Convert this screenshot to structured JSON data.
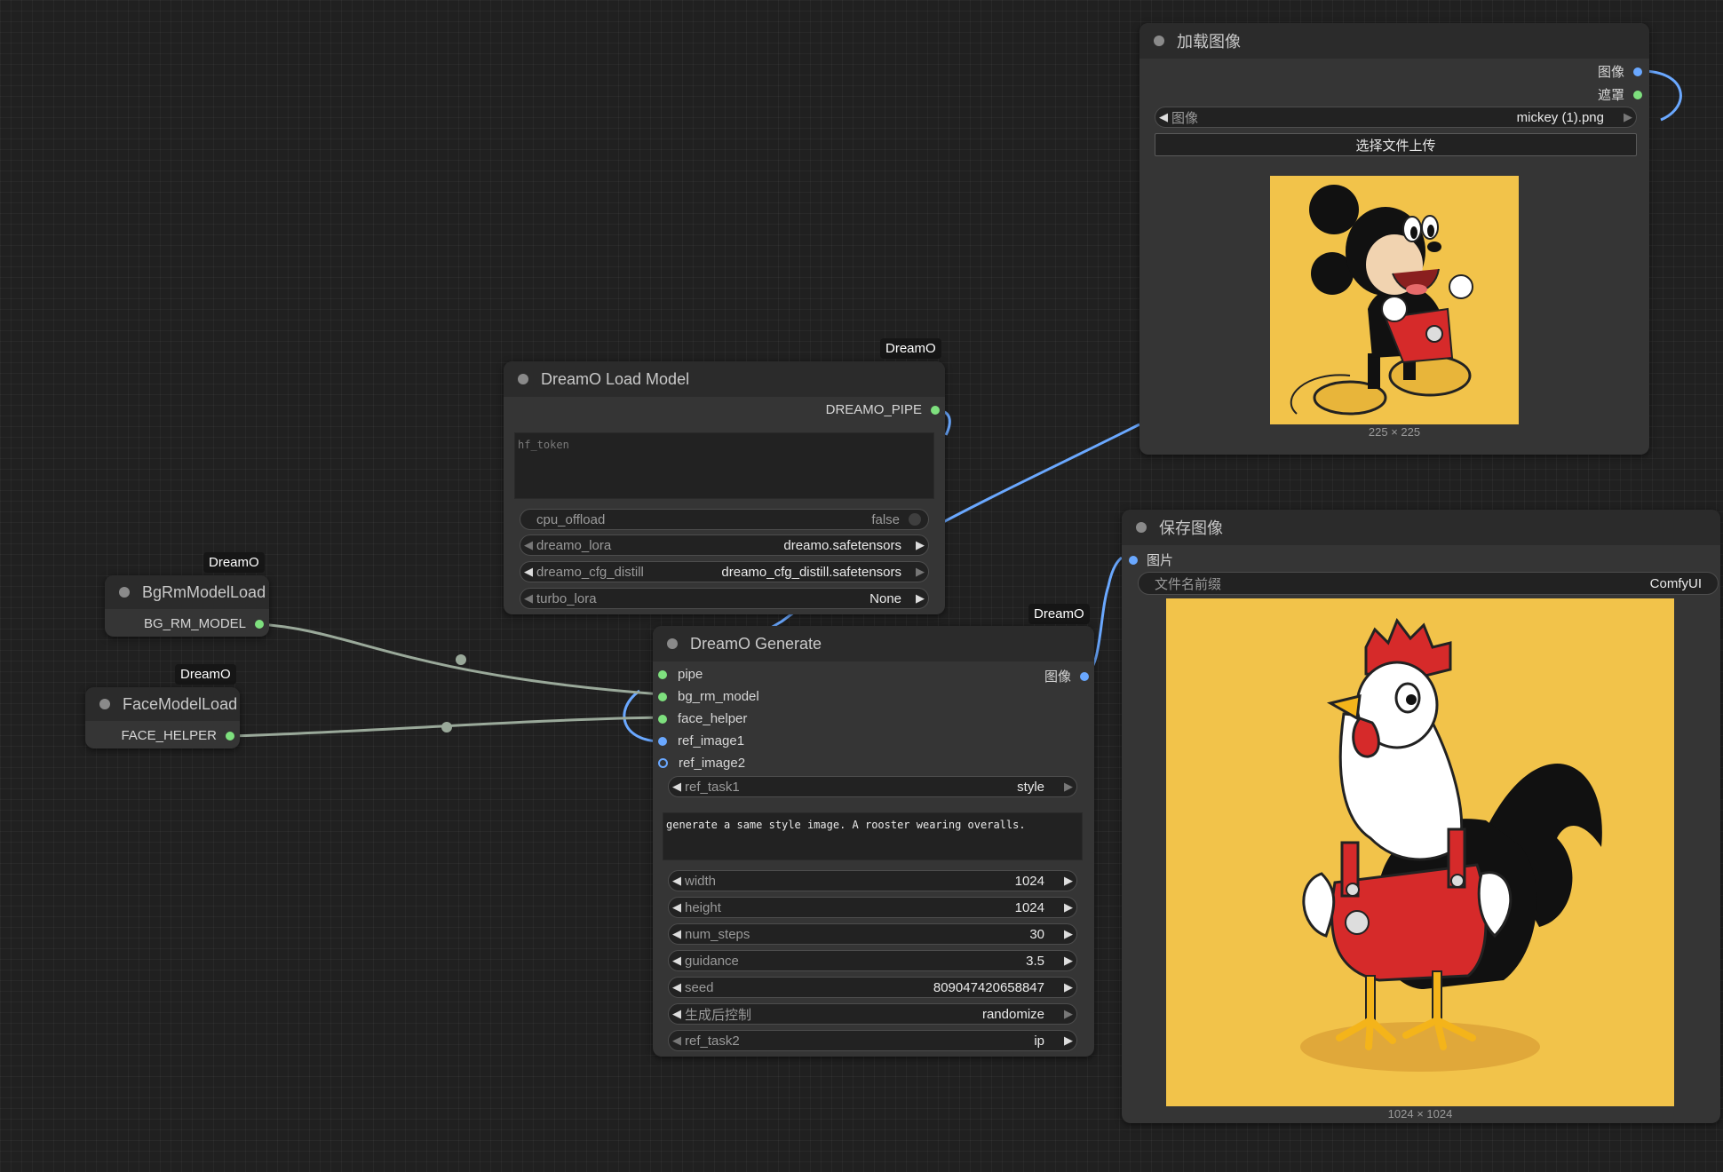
{
  "nodes": {
    "load_image": {
      "title": "加载图像",
      "outputs": [
        "图像",
        "遮罩"
      ],
      "image_widget": {
        "label": "图像",
        "value": "mickey (1).png"
      },
      "upload_button": "选择文件上传",
      "preview_size": "225 × 225"
    },
    "load_model": {
      "badge": "DreamO",
      "title": "DreamO Load Model",
      "output": "DREAMO_PIPE",
      "hf_token_placeholder": "hf_token",
      "widgets": [
        {
          "label": "cpu_offload",
          "value": "false"
        },
        {
          "label": "dreamo_lora",
          "value": "dreamo.safetensors"
        },
        {
          "label": "dreamo_cfg_distill",
          "value": "dreamo_cfg_distill.safetensors"
        },
        {
          "label": "turbo_lora",
          "value": "None"
        }
      ]
    },
    "save_image": {
      "title": "保存图像",
      "input": "图片",
      "filename_prefix": {
        "label": "文件名前缀",
        "value": "ComfyUI"
      },
      "preview_size": "1024 × 1024"
    },
    "bgrm": {
      "badge": "DreamO",
      "title": "BgRmModelLoad",
      "output": "BG_RM_MODEL"
    },
    "face": {
      "badge": "DreamO",
      "title": "FaceModelLoad",
      "output": "FACE_HELPER"
    },
    "generate": {
      "badge": "DreamO",
      "title": "DreamO Generate",
      "inputs": [
        "pipe",
        "bg_rm_model",
        "face_helper",
        "ref_image1",
        "ref_image2"
      ],
      "output": "图像",
      "ref_task1": {
        "label": "ref_task1",
        "value": "style"
      },
      "prompt": "generate a same style image. A rooster wearing overalls.",
      "widgets": [
        {
          "label": "width",
          "value": "1024"
        },
        {
          "label": "height",
          "value": "1024"
        },
        {
          "label": "num_steps",
          "value": "30"
        },
        {
          "label": "guidance",
          "value": "3.5"
        },
        {
          "label": "seed",
          "value": "809047420658847"
        },
        {
          "label": "生成后控制",
          "value": "randomize"
        },
        {
          "label": "ref_task2",
          "value": "ip"
        }
      ]
    }
  },
  "colors": {
    "canvas": "#202020",
    "node_body": "#353535",
    "node_title": "#2b2b2b",
    "wire_image": "#6aa8ff",
    "wire_model": "#9aa99a",
    "slot_green": "#7ee07e",
    "slot_blue": "#6aa8ff",
    "preview_background": "#f2c34a"
  }
}
